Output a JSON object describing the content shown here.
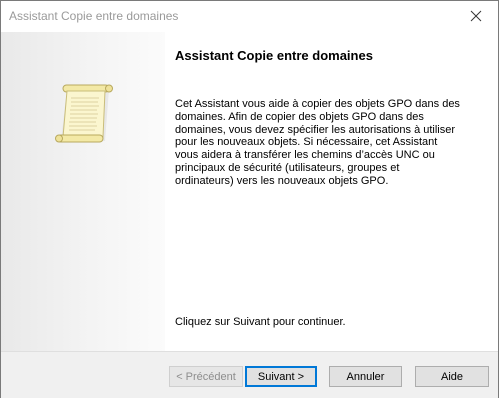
{
  "window": {
    "title": "Assistant Copie entre domaines",
    "close_icon": "close-icon"
  },
  "side_panel": {
    "icon": "scroll-icon",
    "colors": {
      "paper": "#fbf6cf",
      "paper_edge": "#d3c98c"
    }
  },
  "content": {
    "heading": "Assistant Copie entre domaines",
    "description": "Cet Assistant vous aide à copier des objets GPO dans des domaines. Afin de copier des objets GPO dans des domaines, vous devez spécifier les autorisations à utiliser pour les nouveaux objets. Si nécessaire, cet Assistant vous aidera à transférer les chemins d’accès UNC ou principaux de sécurité (utilisateurs, groupes et ordinateurs) vers les nouveaux objets GPO.",
    "footer_note": "Cliquez sur Suivant pour continuer."
  },
  "buttons": {
    "prev": "< Précédent",
    "next": "Suivant >",
    "cancel": "Annuler",
    "help": "Aide"
  },
  "colors": {
    "default_button_border": "#0078d7",
    "title_text": "#9a9a9a"
  }
}
